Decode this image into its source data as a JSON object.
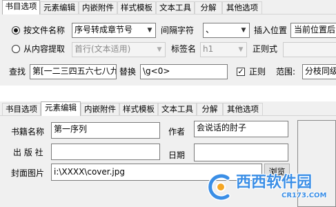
{
  "top_panel": {
    "tabs": [
      {
        "label": "书目选项",
        "active": true
      },
      {
        "label": "元素编辑",
        "active": false
      },
      {
        "label": "内嵌附件",
        "active": false
      },
      {
        "label": "样式模板",
        "active": false
      },
      {
        "label": "文本工具",
        "active": false
      },
      {
        "label": "分解",
        "active": false
      },
      {
        "label": "其他选项",
        "active": false
      }
    ],
    "by_filename_label": "按文件名称",
    "by_filename_value": "序号转成章节号",
    "separator_label": "间隔字符",
    "separator_value": "、",
    "insert_pos_label": "插入位置",
    "insert_pos_value": "当前位置后",
    "from_content_label": "从内容提取",
    "from_content_value": "首行(文本适用)",
    "tag_label": "标签名",
    "tag_value": "h1",
    "regex_label": "正则式",
    "find_label": "查找",
    "find_value": "第[一二三四五六七八九",
    "replace_label": "替换",
    "replace_value": "\\g<0>",
    "regex_check_label": "正则",
    "range_label": "范围:",
    "range_value": "分枝同级"
  },
  "bottom_panel": {
    "tabs": [
      {
        "label": "书目选项",
        "active": false
      },
      {
        "label": "元素编辑",
        "active": true
      },
      {
        "label": "内嵌附件",
        "active": false
      },
      {
        "label": "样式模板",
        "active": false
      },
      {
        "label": "文本工具",
        "active": false
      },
      {
        "label": "分解",
        "active": false
      },
      {
        "label": "其他选项",
        "active": false
      }
    ],
    "book_name_label": "书籍名称",
    "book_name_value": "第一序列",
    "author_label": "作者",
    "author_value": "会说话的肘子",
    "publisher_label": "出 版 社",
    "publisher_value": "",
    "date_label": "日期",
    "date_value": "",
    "cover_label": "封面图片",
    "cover_value": "i:\\XXXX\\cover.jpg",
    "browse_label": "浏览"
  },
  "watermark": {
    "text": "西西软件园",
    "url": "CR173.COM",
    "brand_color": "#3a8ee6"
  }
}
